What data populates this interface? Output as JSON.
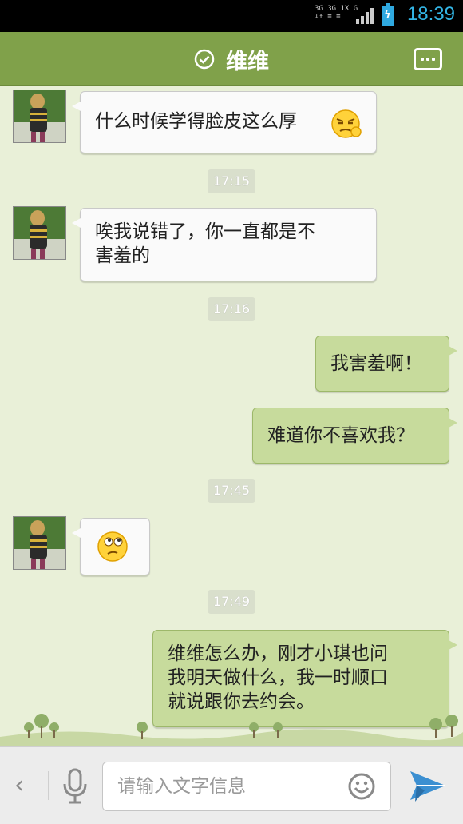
{
  "status_bar": {
    "network_lines": [
      "3G 3G 1X G",
      "↓↑ ≡ ≡"
    ],
    "battery_state": "charging",
    "time": "18:39"
  },
  "header": {
    "title": "维维",
    "status_icon": "check-circle-icon",
    "more_icon": "more-icon"
  },
  "colors": {
    "header_bg": "#80a14a",
    "chat_bg": "#e9f0d8",
    "outgoing_bubble": "#c7db9c",
    "incoming_bubble": "#fafafa",
    "clock_color": "#33b5e5"
  },
  "messages": [
    {
      "type": "incoming",
      "text": "什么时候学得脸皮这么厚",
      "emoji": "sulky-face-icon"
    },
    {
      "type": "time",
      "text": "17:15"
    },
    {
      "type": "incoming",
      "lines": [
        "唉我说错了，你一直都是不",
        "害羞的"
      ]
    },
    {
      "type": "time",
      "text": "17:16"
    },
    {
      "type": "outgoing",
      "text": "我害羞啊！"
    },
    {
      "type": "outgoing",
      "text": "难道你不喜欢我？"
    },
    {
      "type": "time",
      "text": "17:45"
    },
    {
      "type": "incoming",
      "emoji": "thinking-face-icon"
    },
    {
      "type": "time",
      "text": "17:49"
    },
    {
      "type": "outgoing",
      "lines": [
        "维维怎么办，刚才小琪也问",
        "我明天做什么，我一时顺口",
        "就说跟你去约会。"
      ]
    }
  ],
  "input_bar": {
    "placeholder": "请输入文字信息",
    "value": "",
    "back_icon": "chevron-left-icon",
    "voice_icon": "microphone-icon",
    "emoji_icon": "smiley-icon",
    "send_icon": "send-icon"
  }
}
